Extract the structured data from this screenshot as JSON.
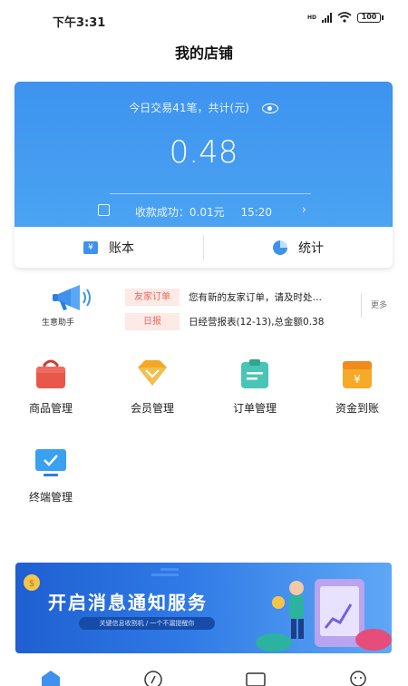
{
  "status_bar": {
    "time": "下午3:31",
    "signal": "HD",
    "battery": "100"
  },
  "header": {
    "title": "我的店铺"
  },
  "summary": {
    "today_label": "今日交易41笔，共计(元)",
    "amount": "0.48",
    "receipt_label": "收款成功：0.01元",
    "receipt_time": "15:20",
    "tabs": [
      {
        "label": "账本",
        "icon": "ledger-icon"
      },
      {
        "label": "统计",
        "icon": "pie-chart-icon"
      }
    ]
  },
  "assistant": {
    "label": "生意助手",
    "rows": [
      {
        "tag": "友家订单",
        "text": "您有新的友家订单，请及时处…"
      },
      {
        "tag": "日报",
        "text": "日经营报表(12-13),总金额0.38"
      }
    ],
    "more": "更多"
  },
  "menu": [
    {
      "label": "商品管理",
      "icon": "shopping-bag-icon"
    },
    {
      "label": "会员管理",
      "icon": "diamond-icon"
    },
    {
      "label": "订单管理",
      "icon": "order-clipboard-icon"
    },
    {
      "label": "资金到账",
      "icon": "wallet-icon"
    },
    {
      "label": "终端管理",
      "icon": "monitor-icon"
    }
  ],
  "banner": {
    "title": "开启消息通知服务",
    "subtitle": "关键信息收割机 / 一个不漏提醒你"
  },
  "colors": {
    "primary": "#3e92ee",
    "tag_bg": "#fde9e6",
    "tag_text": "#e96b5a"
  }
}
